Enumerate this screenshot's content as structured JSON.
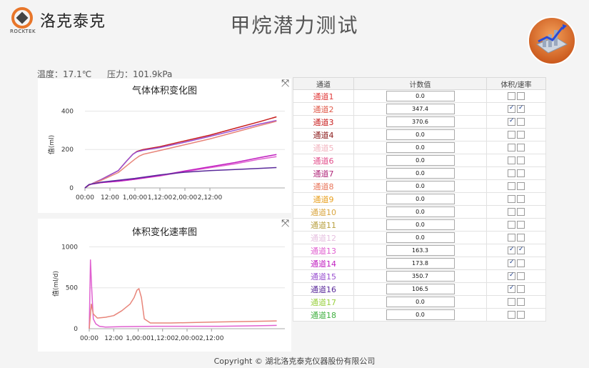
{
  "logo": {
    "brand": "洛克泰克",
    "sub": "ROCKTEK",
    "accent": "#e8762a"
  },
  "title": "甲烷潜力测试",
  "status": {
    "temperature": "温度：17.1℃",
    "pressure": "压力：101.9kPa"
  },
  "table": {
    "headers": [
      "通道",
      "计数值",
      "体积/速率"
    ],
    "rows": [
      {
        "name": "通道1",
        "value": "0.0",
        "vol": false,
        "rate": false,
        "color": "#e03a3a"
      },
      {
        "name": "通道2",
        "value": "347.4",
        "vol": true,
        "rate": true,
        "color": "#e05a4a"
      },
      {
        "name": "通道3",
        "value": "370.6",
        "vol": true,
        "rate": false,
        "color": "#c81e1e"
      },
      {
        "name": "通道4",
        "value": "0.0",
        "vol": false,
        "rate": false,
        "color": "#8b1a1a"
      },
      {
        "name": "通道5",
        "value": "0.0",
        "vol": false,
        "rate": false,
        "color": "#f2b5c0"
      },
      {
        "name": "通道6",
        "value": "0.0",
        "vol": false,
        "rate": false,
        "color": "#e24d8a"
      },
      {
        "name": "通道7",
        "value": "0.0",
        "vol": false,
        "rate": false,
        "color": "#b0287a"
      },
      {
        "name": "通道8",
        "value": "0.0",
        "vol": false,
        "rate": false,
        "color": "#e8755a"
      },
      {
        "name": "通道9",
        "value": "0.0",
        "vol": false,
        "rate": false,
        "color": "#e8a020"
      },
      {
        "name": "通道10",
        "value": "0.0",
        "vol": false,
        "rate": false,
        "color": "#d9a640"
      },
      {
        "name": "通道11",
        "value": "0.0",
        "vol": false,
        "rate": false,
        "color": "#b8a040"
      },
      {
        "name": "通道12",
        "value": "0.0",
        "vol": false,
        "rate": false,
        "color": "#e6c0e0"
      },
      {
        "name": "通道13",
        "value": "163.3",
        "vol": true,
        "rate": true,
        "color": "#e060d0"
      },
      {
        "name": "通道14",
        "value": "173.8",
        "vol": true,
        "rate": false,
        "color": "#c020c0"
      },
      {
        "name": "通道15",
        "value": "350.7",
        "vol": true,
        "rate": false,
        "color": "#9a50d0"
      },
      {
        "name": "通道16",
        "value": "106.5",
        "vol": true,
        "rate": false,
        "color": "#5a2a9a"
      },
      {
        "name": "通道17",
        "value": "0.0",
        "vol": false,
        "rate": false,
        "color": "#9ad040"
      },
      {
        "name": "通道18",
        "value": "0.0",
        "vol": false,
        "rate": false,
        "color": "#40b040"
      }
    ]
  },
  "chart_data": [
    {
      "type": "line",
      "title": "气体体积变化图",
      "ylabel": "值(ml)",
      "xlabel": "",
      "ylim": [
        0,
        450
      ],
      "xlim": [
        0,
        48
      ],
      "y_ticks": [
        "0",
        "200",
        "400"
      ],
      "x_tick_values": [
        0,
        6,
        12,
        18,
        24,
        30,
        36
      ],
      "x_ticks": [
        "00:00",
        "12:00",
        "1,00:00",
        "1,12:00",
        "2,00:00",
        "2,12:00"
      ],
      "grid": true,
      "series": [
        {
          "color": "#c81e1e",
          "x": [
            0,
            1,
            4,
            8,
            10,
            11.5,
            12.5,
            14,
            18,
            24,
            30,
            36,
            42,
            46
          ],
          "y": [
            0,
            15,
            45,
            90,
            140,
            175,
            190,
            200,
            215,
            245,
            275,
            310,
            345,
            370
          ]
        },
        {
          "color": "#9a50d0",
          "x": [
            0,
            1,
            4,
            8,
            10,
            11.5,
            12.5,
            14,
            18,
            24,
            30,
            36,
            42,
            46
          ],
          "y": [
            0,
            15,
            45,
            90,
            140,
            175,
            188,
            196,
            210,
            238,
            268,
            300,
            333,
            351
          ]
        },
        {
          "color": "#e8857a",
          "x": [
            0,
            1,
            4,
            8,
            10,
            12,
            13,
            14,
            18,
            24,
            30,
            36,
            42,
            46
          ],
          "y": [
            0,
            15,
            40,
            80,
            115,
            150,
            165,
            175,
            195,
            225,
            255,
            290,
            325,
            347
          ]
        },
        {
          "color": "#e060d0",
          "x": [
            0,
            1,
            4,
            8,
            12,
            18,
            24,
            30,
            36,
            42,
            46
          ],
          "y": [
            0,
            18,
            28,
            35,
            45,
            62,
            85,
            105,
            125,
            150,
            163
          ]
        },
        {
          "color": "#c020c0",
          "x": [
            0,
            1,
            4,
            8,
            12,
            18,
            24,
            30,
            36,
            42,
            46
          ],
          "y": [
            0,
            18,
            28,
            35,
            45,
            65,
            88,
            110,
            132,
            158,
            174
          ]
        },
        {
          "color": "#5a2a9a",
          "x": [
            0,
            1,
            4,
            8,
            12,
            18,
            24,
            30,
            36,
            42,
            46
          ],
          "y": [
            0,
            18,
            30,
            40,
            50,
            68,
            82,
            90,
            96,
            102,
            106
          ]
        }
      ]
    },
    {
      "type": "line",
      "title": "体积变化速率图",
      "ylabel": "值(ml/d)",
      "xlabel": "",
      "ylim": [
        0,
        1100
      ],
      "xlim": [
        0,
        48
      ],
      "y_ticks": [
        "0",
        "500",
        "1000"
      ],
      "x_tick_values": [
        0,
        6,
        12,
        18,
        24,
        30,
        36
      ],
      "x_ticks": [
        "00:00",
        "12:00",
        "1,00:00",
        "1,12:00",
        "2,00:00",
        "2,12:00"
      ],
      "grid": true,
      "series": [
        {
          "color": "#e060d0",
          "x": [
            0,
            0.3,
            0.6,
            1,
            1.6,
            2.5,
            4,
            8,
            16,
            24,
            32,
            40,
            46
          ],
          "y": [
            0,
            840,
            500,
            120,
            60,
            30,
            20,
            25,
            30,
            30,
            30,
            35,
            40
          ]
        },
        {
          "color": "#e8857a",
          "x": [
            0,
            0.5,
            1,
            2,
            4,
            6,
            8,
            10,
            11,
            11.7,
            12.2,
            12.8,
            13.5,
            15,
            20,
            30,
            40,
            46
          ],
          "y": [
            0,
            300,
            180,
            130,
            140,
            160,
            220,
            300,
            380,
            470,
            490,
            380,
            120,
            70,
            70,
            80,
            90,
            95
          ]
        }
      ]
    }
  ],
  "footer": "Copyright © 湖北洛克泰克仪器股份有限公司"
}
